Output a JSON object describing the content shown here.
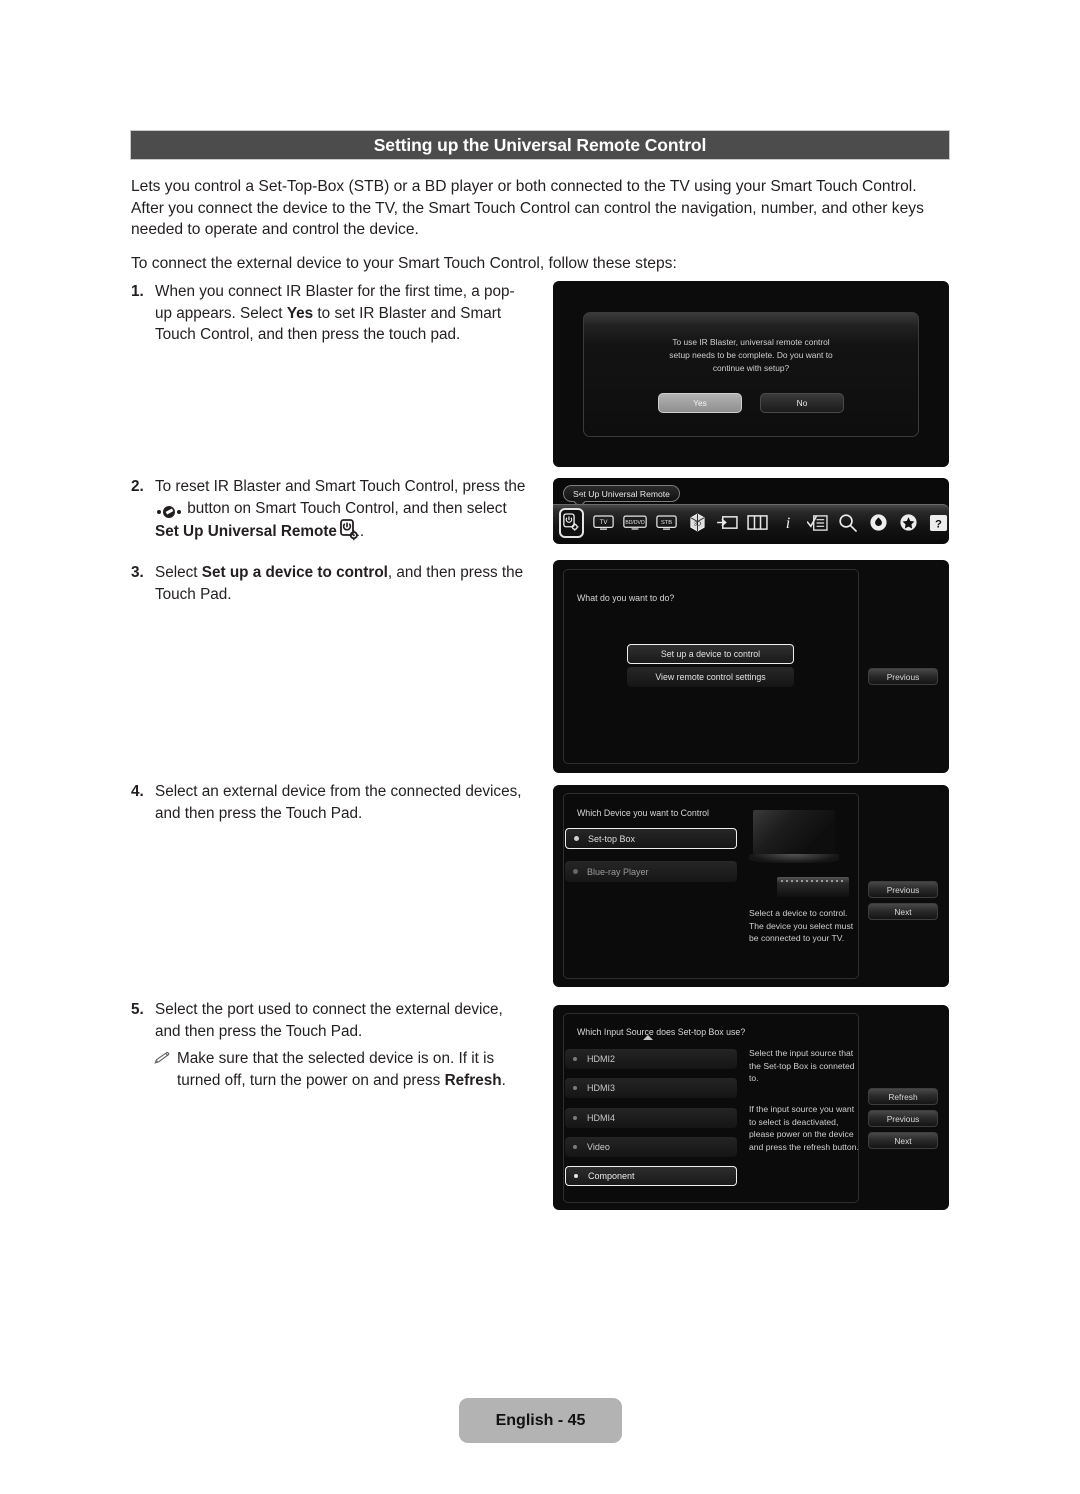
{
  "header": {
    "title": "Setting up the Universal Remote Control"
  },
  "intro": {
    "paragraph1": "Lets you control a Set-Top-Box (STB) or a BD player or both connected to the TV using your Smart Touch Control. After you connect the device to the TV, the Smart Touch Control can control the navigation, number, and other keys needed to operate and control the device.",
    "paragraph2": "To connect the external device to your Smart Touch Control, follow these steps:"
  },
  "steps": {
    "step1": {
      "number": "1.",
      "text_a": "When you connect IR Blaster for the first time, a pop-up appears. Select ",
      "bold_a": "Yes",
      "text_b": " to set IR Blaster and Smart Touch Control, and then press the touch pad."
    },
    "step2": {
      "number": "2.",
      "text_a": "To reset IR Blaster and Smart Touch Control, press the ",
      "text_b": " button on Smart Touch Control, and then select ",
      "bold_a": "Set Up Universal Remote",
      "text_c": "."
    },
    "step3": {
      "number": "3.",
      "text_a": "Select ",
      "bold_a": "Set up a device to control",
      "text_b": ", and then press the Touch Pad."
    },
    "step4": {
      "number": "4.",
      "text_a": "Select an external device from the connected devices, and then press the Touch Pad."
    },
    "step5": {
      "number": "5.",
      "text_a": "Select the port used to connect the external device, and then press the Touch Pad.",
      "note_a": "Make sure that the selected device is on. If it is turned off, turn the power on and press ",
      "note_bold": "Refresh",
      "note_b": "."
    }
  },
  "screens": {
    "popup": {
      "message_line1": "To use IR Blaster, universal remote control",
      "message_line2": "setup needs to be complete. Do you want to",
      "message_line3": "continue with setup?",
      "yes_label": "Yes",
      "no_label": "No"
    },
    "toolbar": {
      "tooltip": "Set Up Universal Remote",
      "icons": [
        {
          "name": "set-up-universal-remote-icon",
          "glyph": "⏻",
          "selected": true
        },
        {
          "name": "tv-icon",
          "glyph": "TV",
          "selected": false
        },
        {
          "name": "bd-dvd-icon",
          "glyph": "BD/DVD",
          "selected": false
        },
        {
          "name": "stb-icon",
          "glyph": "STB",
          "selected": false
        },
        {
          "name": "3d-icon",
          "glyph": "3D",
          "selected": false
        },
        {
          "name": "source-input-icon",
          "glyph": "⊣",
          "selected": false
        },
        {
          "name": "multi-view-icon",
          "glyph": "‖",
          "selected": false
        },
        {
          "name": "info-icon",
          "glyph": "i",
          "selected": false
        },
        {
          "name": "menu-list-icon",
          "glyph": "≡",
          "selected": false
        },
        {
          "name": "search-icon",
          "glyph": "⚲",
          "selected": false
        },
        {
          "name": "smart-hub-icon",
          "glyph": "♠",
          "selected": false
        },
        {
          "name": "apps-icon",
          "glyph": "✦",
          "selected": false
        },
        {
          "name": "help-icon",
          "glyph": "?",
          "selected": false
        }
      ]
    },
    "what_to_do": {
      "question": "What do you want to do?",
      "option_setup": "Set up a device to control",
      "option_view": "View remote control settings",
      "previous_label": "Previous"
    },
    "which_device": {
      "question": "Which Device you want to Control",
      "options": [
        {
          "label": "Set-top Box",
          "selected": true
        },
        {
          "label": "Blue-ray Player",
          "selected": false
        }
      ],
      "help_text": "Select a device to control. The device you select must be connected to your TV.",
      "previous_label": "Previous",
      "next_label": "Next"
    },
    "input_source": {
      "question": "Which Input Source does Set-top Box use?",
      "options": [
        {
          "label": "HDMI2",
          "selected": false
        },
        {
          "label": "HDMI3",
          "selected": false
        },
        {
          "label": "HDMI4",
          "selected": false
        },
        {
          "label": "Video",
          "selected": false
        },
        {
          "label": "Component",
          "selected": true
        }
      ],
      "help_text_1": "Select the input source that the Set-top Box is conneted to.",
      "help_text_2": "If the input source you want to select is deactivated, please power on the device and press the refresh button.",
      "refresh_label": "Refresh",
      "previous_label": "Previous",
      "next_label": "Next"
    }
  },
  "footer": {
    "page_label": "English - 45"
  },
  "colors": {
    "header_bar": "#4c4c4c",
    "text": "#231f20",
    "screen_background": "#0c0c0c",
    "footer_background": "#b3b3b3"
  }
}
